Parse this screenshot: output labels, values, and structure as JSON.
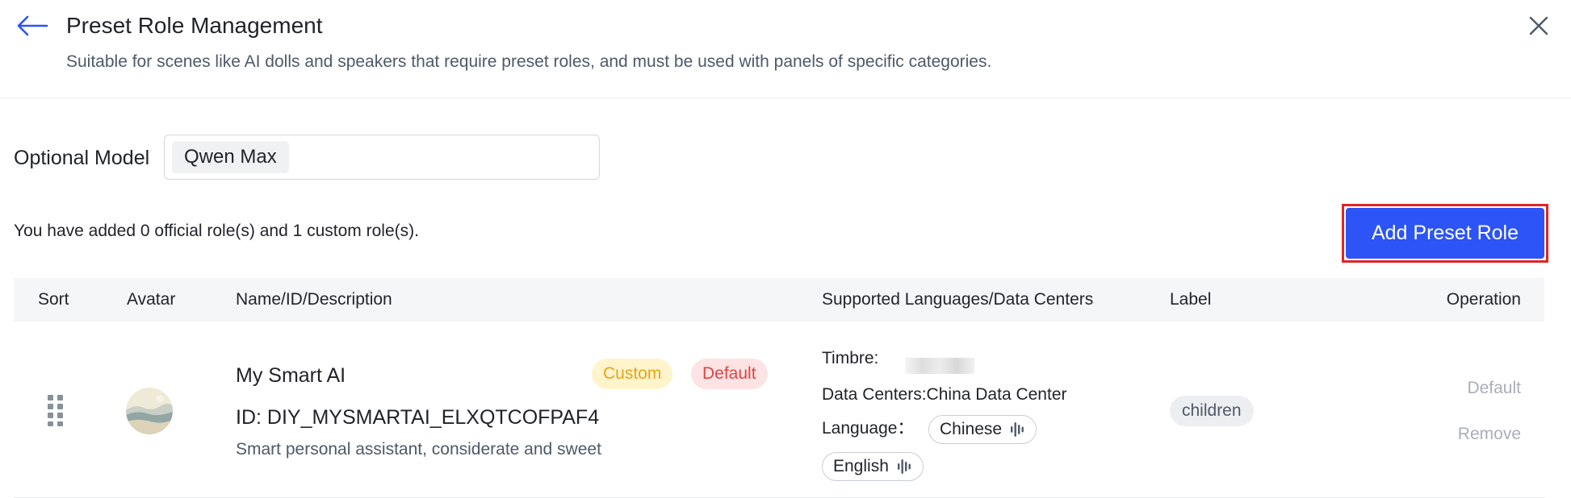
{
  "header": {
    "title": "Preset Role Management",
    "subtitle": "Suitable for scenes like AI dolls and speakers that require preset roles, and must be used with panels of specific categories."
  },
  "model": {
    "label": "Optional Model",
    "selected": "Qwen Max"
  },
  "summary": {
    "text": "You have added 0 official role(s) and 1 custom role(s).",
    "add_button_label": "Add Preset Role"
  },
  "colors": {
    "primary": "#2c54f6",
    "highlight": "#e02424",
    "custom_badge": "#e8a317",
    "default_badge": "#e04343"
  },
  "table": {
    "headers": {
      "sort": "Sort",
      "avatar": "Avatar",
      "name": "Name/ID/Description",
      "languages": "Supported Languages/Data Centers",
      "label": "Label",
      "operation": "Operation"
    },
    "rows": [
      {
        "name": "My Smart AI",
        "badges": {
          "custom": "Custom",
          "default": "Default"
        },
        "id": "ID: DIY_MYSMARTAI_ELXQTCOFPAF4",
        "description": "Smart personal assistant, considerate and sweet",
        "timbre_label": "Timbre:",
        "data_centers": "Data Centers:China Data Center",
        "language_label": "Language：",
        "languages": [
          "Chinese",
          "English"
        ],
        "label": "children",
        "operations": {
          "default": "Default",
          "remove": "Remove"
        }
      }
    ]
  },
  "icons": {
    "back": "arrow-left-icon",
    "close": "close-icon",
    "drag": "drag-handle-icon",
    "voice": "voice-wave-icon"
  }
}
